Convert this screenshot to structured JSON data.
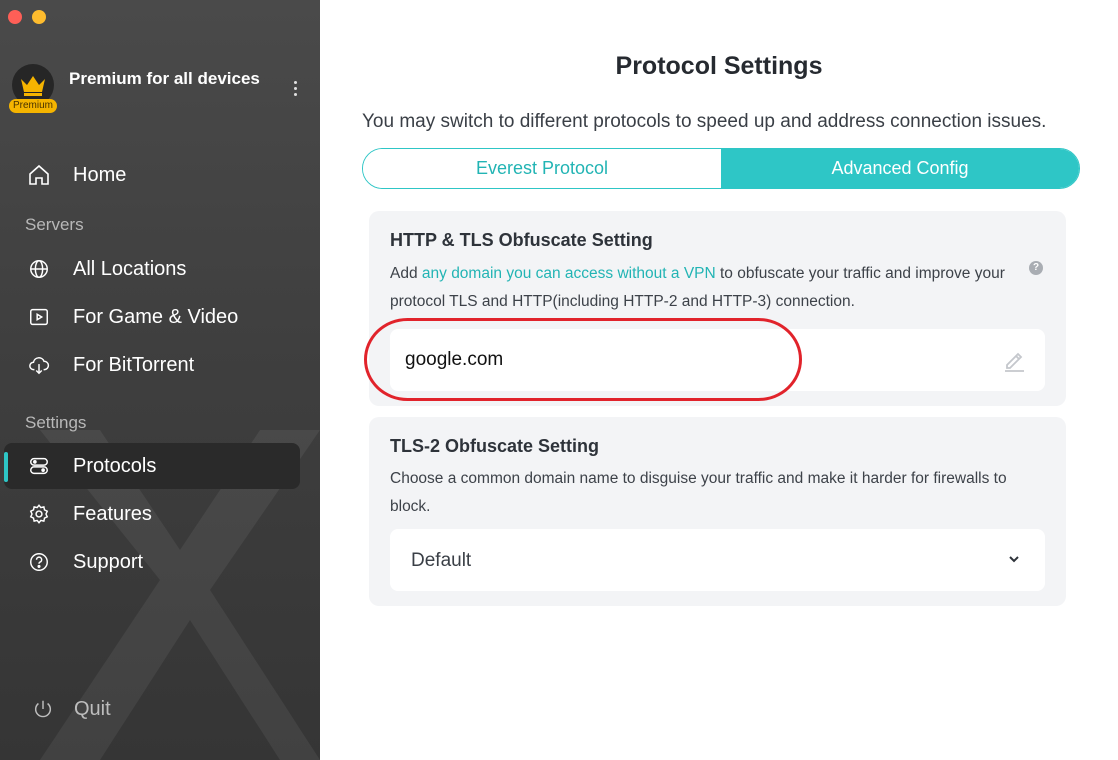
{
  "window": {
    "controls": [
      "close",
      "minimize"
    ]
  },
  "account": {
    "name": "Premium for all devices",
    "badge": "Premium",
    "icon": "crown-icon"
  },
  "sidebar": {
    "home": {
      "label": "Home",
      "icon": "home-icon"
    },
    "servers_label": "Servers",
    "servers": [
      {
        "label": "All Locations",
        "icon": "globe-icon"
      },
      {
        "label": "For Game & Video",
        "icon": "play-icon"
      },
      {
        "label": "For BitTorrent",
        "icon": "cloud-download-icon"
      }
    ],
    "settings_label": "Settings",
    "settings": [
      {
        "label": "Protocols",
        "icon": "protocols-icon",
        "active": true
      },
      {
        "label": "Features",
        "icon": "gear-icon"
      },
      {
        "label": "Support",
        "icon": "question-icon"
      }
    ],
    "quit": {
      "label": "Quit",
      "icon": "power-icon"
    }
  },
  "main": {
    "title": "Protocol Settings",
    "subtitle": "You may switch to different protocols to speed up and address connection issues.",
    "tabs": [
      {
        "label": "Everest Protocol",
        "active": false
      },
      {
        "label": "Advanced Config",
        "active": true
      }
    ],
    "http_tls": {
      "title": "HTTP & TLS Obfuscate Setting",
      "desc_prefix": "Add ",
      "desc_link": "any domain you can access without a VPN",
      "desc_suffix": " to obfuscate your traffic and improve your protocol TLS and HTTP(including HTTP-2 and HTTP-3) connection.",
      "help": "?",
      "domain_value": "google.com"
    },
    "tls2": {
      "title": "TLS-2 Obfuscate Setting",
      "desc": "Choose a common domain name to disguise your traffic and make it harder for firewalls to block.",
      "selected": "Default"
    }
  },
  "colors": {
    "accent": "#2ec6c6",
    "sidebar_bg": "#404040",
    "highlight": "#e1232b",
    "premium": "#f5b400"
  }
}
